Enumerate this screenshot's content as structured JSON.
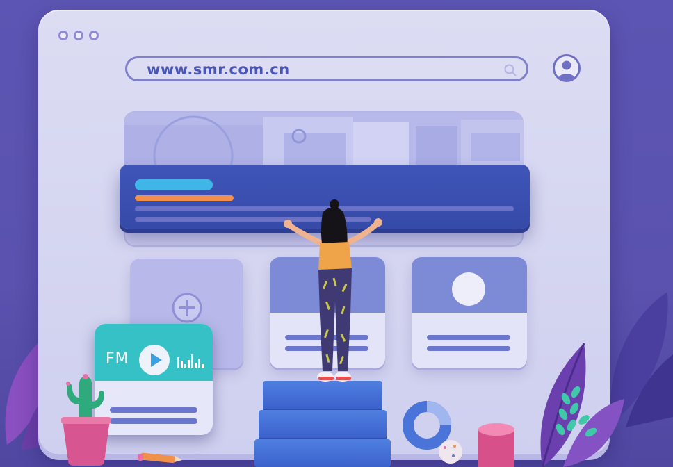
{
  "browser": {
    "url": "www.smr.com.cn"
  },
  "widget": {
    "fm_label": "FM"
  },
  "colors": {
    "background": "#5b53b0",
    "browser": "#d3d3f1",
    "accent_blue": "#3a50b4",
    "accent_cyan": "#35c1c6",
    "accent_orange": "#f0904a",
    "pink": "#e9649b"
  },
  "icons": [
    "window-dot-icon",
    "search-icon",
    "user-avatar-icon",
    "plus-icon",
    "play-icon",
    "equalizer-icon"
  ]
}
